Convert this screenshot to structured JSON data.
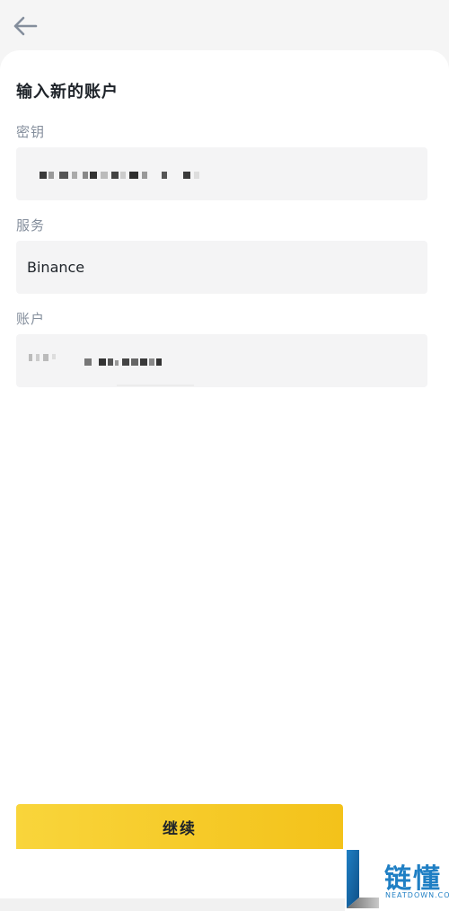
{
  "header": {
    "back_icon": "arrow-left-icon"
  },
  "form": {
    "title": "输入新的账户",
    "key": {
      "label": "密钥",
      "value_masked": true
    },
    "service": {
      "label": "服务",
      "value": "Binance"
    },
    "account": {
      "label": "账户",
      "value_masked": true
    }
  },
  "actions": {
    "continue_label": "继续"
  },
  "watermark": {
    "name": "链懂",
    "sub": "NEATDOWN.COM"
  },
  "colors": {
    "accent_yellow": "#f3c21a",
    "field_bg": "#f4f4f5",
    "label_gray": "#848e9c",
    "watermark_blue": "#1f7fc4"
  }
}
